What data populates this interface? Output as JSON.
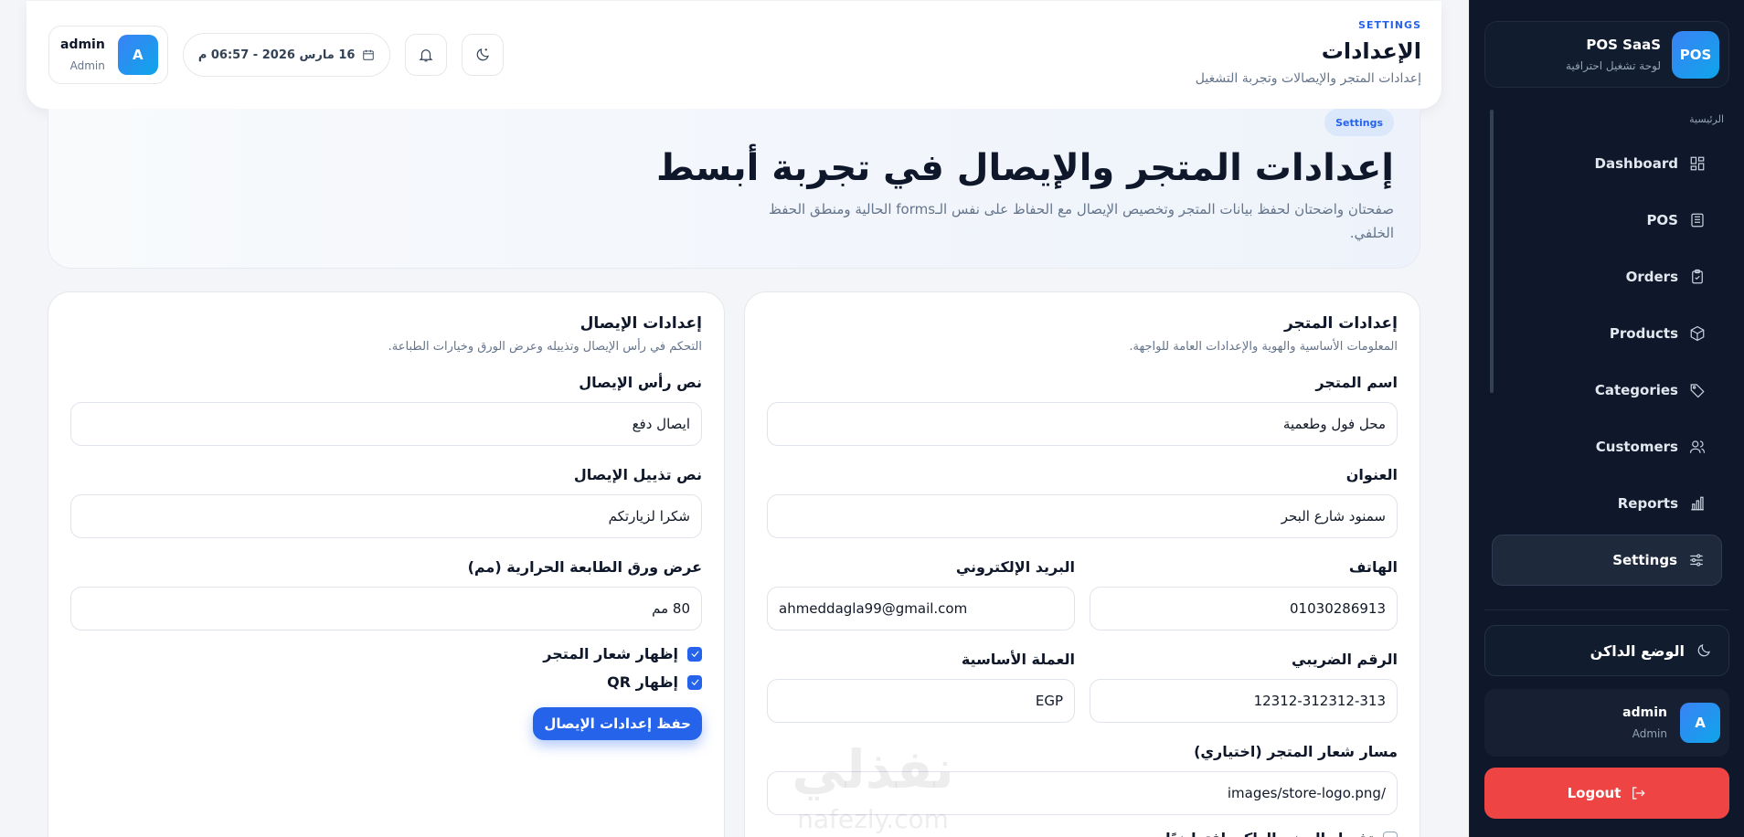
{
  "sidebar": {
    "brand_name": "POS SaaS",
    "brand_sub": "لوحة تشغيل احترافية",
    "brand_logo": "POS",
    "section_label": "الرئيسية",
    "items": [
      {
        "label": "Dashboard",
        "icon": "dashboard-icon",
        "active": false
      },
      {
        "label": "POS",
        "icon": "pos-icon",
        "active": false
      },
      {
        "label": "Orders",
        "icon": "orders-icon",
        "active": false
      },
      {
        "label": "Products",
        "icon": "box-icon",
        "active": false
      },
      {
        "label": "Categories",
        "icon": "tag-icon",
        "active": false
      },
      {
        "label": "Customers",
        "icon": "users-icon",
        "active": false
      },
      {
        "label": "Reports",
        "icon": "bar-chart-icon",
        "active": false
      },
      {
        "label": "Settings",
        "icon": "sliders-icon",
        "active": true
      }
    ],
    "dark_mode_label": "الوضع الداكن",
    "user": {
      "initial": "A",
      "name": "admin",
      "role": "Admin"
    },
    "logout_label": "Logout"
  },
  "header": {
    "kicker": "SETTINGS",
    "title": "الإعدادات",
    "subtitle": "إعدادات المتجر والإيصالات وتجربة التشغيل",
    "date": "16 مارس 2026 - 06:57 م",
    "user": {
      "initial": "A",
      "name": "admin",
      "role": "Admin"
    }
  },
  "hero": {
    "badge": "Settings",
    "title": "إعدادات المتجر والإيصال في تجربة أبسط",
    "subtitle": "صفحتان واضحتان لحفظ بيانات المتجر وتخصيص الإيصال مع الحفاظ على نفس الـforms الحالية ومنطق الحفظ الخلفي."
  },
  "store": {
    "title": "إعدادات المتجر",
    "subtitle": "المعلومات الأساسية والهوية والإعدادات العامة للواجهة.",
    "name_label": "اسم المتجر",
    "name_value": "محل فول وطعمية",
    "address_label": "العنوان",
    "address_value": "سمنود شارع البحر",
    "phone_label": "الهاتف",
    "phone_value": "01030286913",
    "email_label": "البريد الإلكتروني",
    "email_value": "ahmeddagla99@gmail.com",
    "tax_label": "الرقم الضريبي",
    "tax_value": "12312-312312-313",
    "currency_label": "العملة الأساسية",
    "currency_value": "EGP",
    "logo_label": "مسار شعار المتجر (اختياري)",
    "logo_value": "/images/store-logo.png",
    "dark_default_label": "تفعيل الوضع الداكن افتراضيًا",
    "dark_default_checked": false
  },
  "receipt": {
    "title": "إعدادات الإيصال",
    "subtitle": "التحكم في رأس الإيصال وتذييله وعرض الورق وخيارات الطباعة.",
    "header_label": "نص رأس الإيصال",
    "header_value": "ايصال دفع",
    "footer_label": "نص تذييل الإيصال",
    "footer_value": "شكرا لزيارتكم",
    "width_label": "عرض ورق الطابعة الحرارية (مم)",
    "width_value": "80 مم",
    "show_logo_label": "إظهار شعار المتجر",
    "show_logo_checked": true,
    "show_qr_label": "إظهار QR",
    "show_qr_checked": true,
    "save_label": "حفظ إعدادات الإيصال"
  },
  "watermark": {
    "arabic": "نفذلي",
    "latin": "nafezly.com"
  },
  "colors": {
    "accent": "#2563eb",
    "sidebar_bg": "#0f172a",
    "logout": "#ef4444"
  }
}
